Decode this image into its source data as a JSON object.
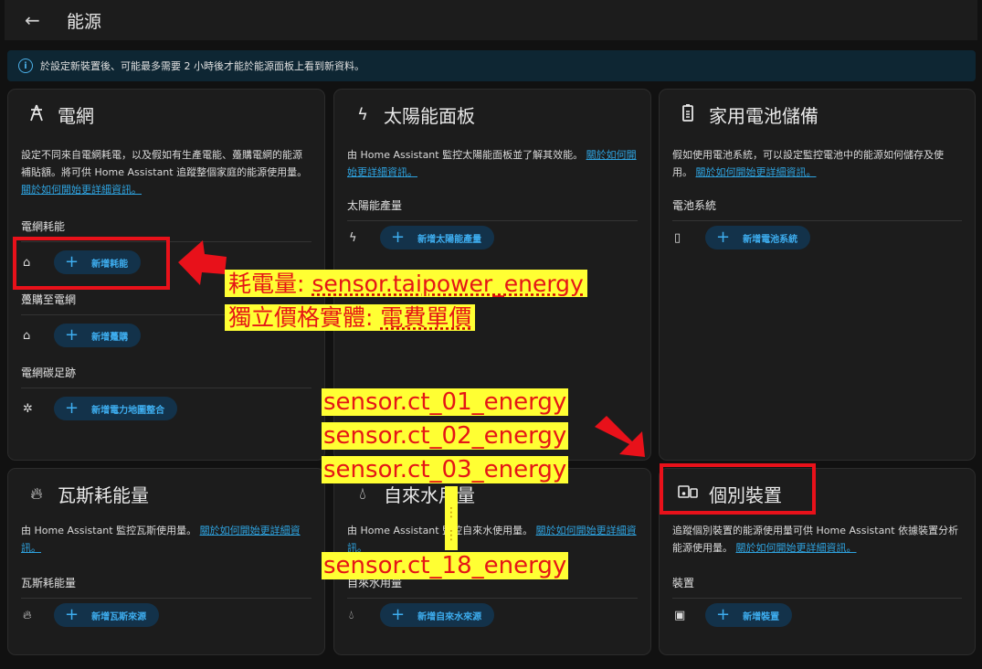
{
  "header": {
    "back_icon": "arrow-left-icon",
    "title": "能源"
  },
  "notice": {
    "text": "於設定新裝置後、可能最多需要 2 小時後才能於能源面板上看到新資料。"
  },
  "grid": {
    "title": "電網",
    "desc": "設定不同來自電網耗電，以及假如有生產電能、躉購電網的能源補貼額。將可供 Home Assistant 追蹤整個家庭的能源使用量。",
    "link": "關於如何開始更詳細資訊。",
    "consumption": {
      "title": "電網耗能",
      "button": "新增耗能"
    },
    "return": {
      "title": "躉購至電網",
      "button": "新增躉購"
    },
    "carbon": {
      "title": "電網碳足跡",
      "button": "新增電力地圖整合"
    }
  },
  "solar": {
    "title": "太陽能面板",
    "desc": "由 Home Assistant 監控太陽能面板並了解其效能。",
    "link": "關於如何開始更詳細資訊。",
    "section": "太陽能產量",
    "button": "新增太陽能產量"
  },
  "battery": {
    "title": "家用電池儲備",
    "desc": "假如使用電池系統，可以設定監控電池中的能源如何儲存及使用。",
    "link": "關於如何開始更詳細資訊。",
    "section": "電池系統",
    "button": "新增電池系統"
  },
  "gas": {
    "title": "瓦斯耗能量",
    "desc": "由 Home Assistant 監控瓦斯使用量。",
    "link": "關於如何開始更詳細資訊。",
    "section": "瓦斯耗能量",
    "button": "新增瓦斯來源"
  },
  "water": {
    "title": "自來水用量",
    "desc": "由 Home Assistant 監控自來水使用量。",
    "link": "關於如何開始更詳細資訊。",
    "section": "自來水用量",
    "button": "新增自來水來源"
  },
  "devices": {
    "title": "個別裝置",
    "desc": "追蹤個別裝置的能源使用量可供 Home Assistant 依據裝置分析能源使用量。",
    "link": "關於如何開始更詳細資訊。",
    "section": "裝置",
    "button": "新增裝置"
  },
  "annotations": {
    "consumption_label": "耗電量: ",
    "consumption_value": "sensor.taipower_energy",
    "price_label": "獨立價格實體: ",
    "price_value": "電費單價",
    "ct1": "sensor.ct_01_energy",
    "ct2": "sensor.ct_02_energy",
    "ct3": "sensor.ct_03_energy",
    "ct18": "sensor.ct_18_energy"
  },
  "colors": {
    "accent": "#3eaef0",
    "annotation_red": "#e8111a",
    "annotation_yellow": "#ffff33"
  }
}
